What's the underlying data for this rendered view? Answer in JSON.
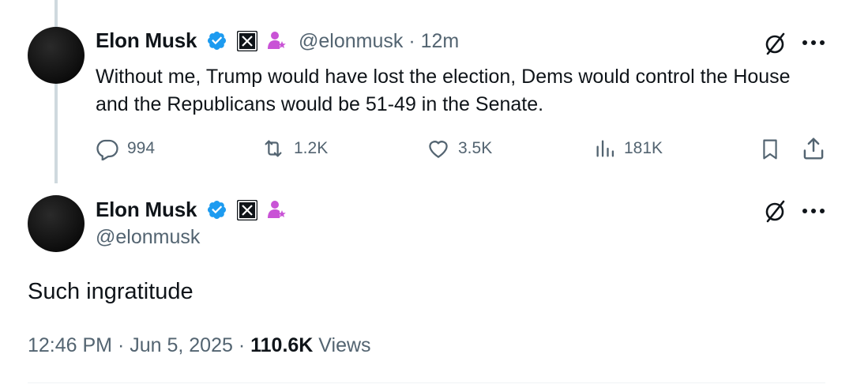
{
  "colors": {
    "verified_blue": "#1d9bf0",
    "secondary_text": "#536471",
    "primary_text": "#0f1419",
    "pink_accent": "#c953d6"
  },
  "reply_tweet": {
    "display_name": "Elon Musk",
    "handle_meta": "@elonmusk · 12m",
    "text": "Without me, Trump would have lost the election, Dems would control the House and the Republicans would be 51-49 in the Senate.",
    "replies": "994",
    "reposts": "1.2K",
    "likes": "3.5K",
    "views": "181K",
    "icons": [
      "verified-badge-icon",
      "x-logo-icon",
      "pink-person-icon",
      "grok-icon",
      "more-icon",
      "reply-icon",
      "repost-icon",
      "like-icon",
      "views-icon",
      "bookmark-icon",
      "share-icon"
    ]
  },
  "main_tweet": {
    "display_name": "Elon Musk",
    "handle": "@elonmusk",
    "text": "Such ingratitude",
    "time": "12:46 PM · Jun 5, 2025 · ",
    "views_count": "110.6K",
    "views_label": " Views"
  }
}
